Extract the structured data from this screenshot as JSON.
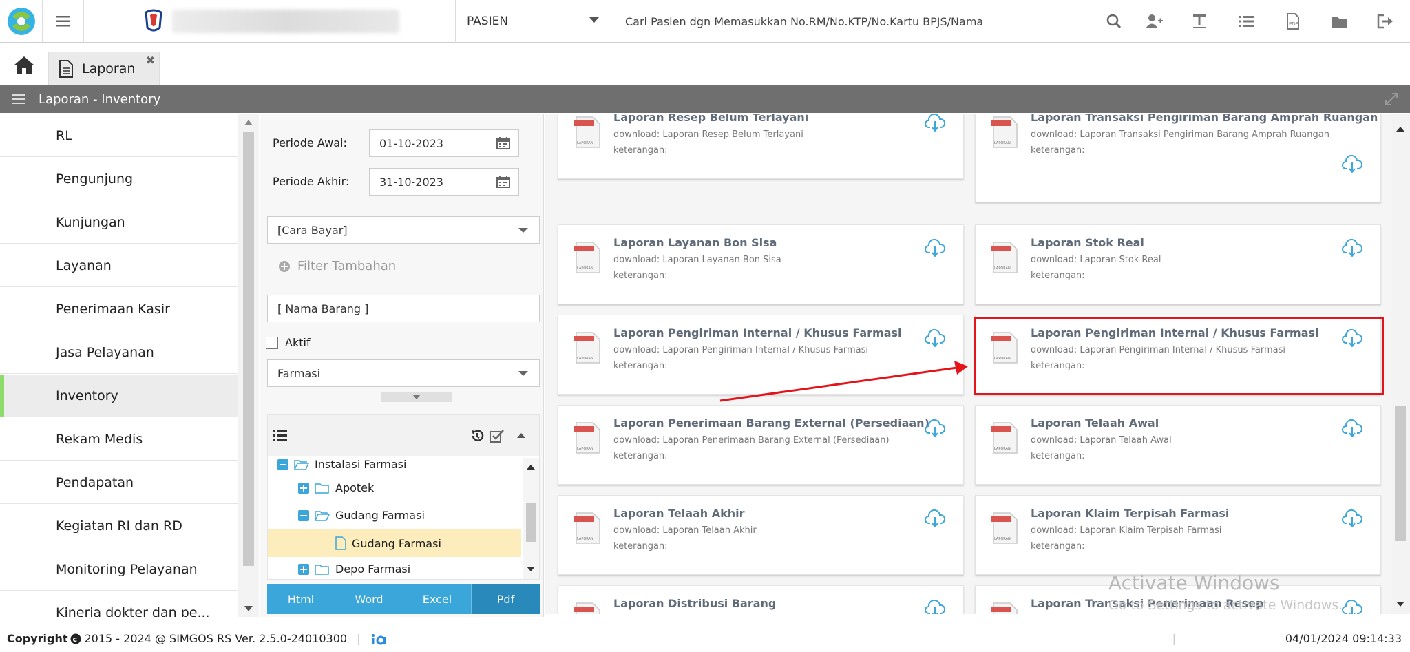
{
  "topbar": {
    "patient_select": "PASIEN",
    "search_placeholder": "Cari Pasien dgn Memasukkan No.RM/No.KTP/No.Kartu BPJS/Nama"
  },
  "tabs": [
    {
      "label": "Laporan"
    }
  ],
  "title": "Laporan - Inventory",
  "sidebar": {
    "items": [
      {
        "label": "RL"
      },
      {
        "label": "Pengunjung"
      },
      {
        "label": "Kunjungan"
      },
      {
        "label": "Layanan"
      },
      {
        "label": "Penerimaan Kasir"
      },
      {
        "label": "Jasa Pelayanan"
      },
      {
        "label": "Inventory"
      },
      {
        "label": "Rekam Medis"
      },
      {
        "label": "Pendapatan"
      },
      {
        "label": "Kegiatan RI dan RD"
      },
      {
        "label": "Monitoring Pelayanan"
      },
      {
        "label": "Kinerja dokter dan pe..."
      }
    ],
    "active_index": 6
  },
  "filter": {
    "periode_awal_label": "Periode Awal:",
    "periode_awal_value": "01-10-2023",
    "periode_akhir_label": "Periode Akhir:",
    "periode_akhir_value": "31-10-2023",
    "cara_bayar": "[Cara Bayar]",
    "filter_tambahan": "Filter Tambahan",
    "nama_barang": "[ Nama Barang ]",
    "aktif_label": "Aktif",
    "jenis": "Farmasi"
  },
  "tree": {
    "nodes": [
      {
        "label": "Instalasi Farmasi"
      },
      {
        "label": "Apotek"
      },
      {
        "label": "Gudang Farmasi"
      },
      {
        "label": "Gudang Farmasi"
      },
      {
        "label": "Depo Farmasi"
      }
    ]
  },
  "format_buttons": [
    {
      "label": "Html"
    },
    {
      "label": "Word"
    },
    {
      "label": "Excel"
    },
    {
      "label": "Pdf"
    }
  ],
  "reports": [
    {
      "title": "Laporan Resep Belum Terlayani",
      "download": "download: Laporan Resep Belum Terlayani",
      "keterangan": "keterangan:"
    },
    {
      "title": "Laporan Transaksi Pengiriman Barang Amprah Ruangan",
      "download": "download: Laporan Transaksi Pengiriman Barang Amprah Ruangan",
      "keterangan": "keterangan:"
    },
    {
      "title": "Laporan Layanan Bon Sisa",
      "download": "download: Laporan Layanan Bon Sisa",
      "keterangan": "keterangan:"
    },
    {
      "title": "Laporan Stok Real",
      "download": "download: Laporan Stok Real",
      "keterangan": "keterangan:"
    },
    {
      "title": "Laporan Pengiriman Internal / Khusus Farmasi",
      "download": "download: Laporan Pengiriman Internal / Khusus Farmasi",
      "keterangan": "keterangan:"
    },
    {
      "title": "Laporan Pengiriman Internal / Khusus Farmasi",
      "download": "download: Laporan Pengiriman Internal / Khusus Farmasi",
      "keterangan": "keterangan:"
    },
    {
      "title": "Laporan Penerimaan Barang External (Persediaan)",
      "download": "download: Laporan Penerimaan Barang External (Persediaan)",
      "keterangan": "keterangan:"
    },
    {
      "title": "Laporan Telaah Awal",
      "download": "download: Laporan Telaah Awal",
      "keterangan": "keterangan:"
    },
    {
      "title": "Laporan Telaah Akhir",
      "download": "download: Laporan Telaah Akhir",
      "keterangan": "keterangan:"
    },
    {
      "title": "Laporan Klaim Terpisah Farmasi",
      "download": "download: Laporan Klaim Terpisah Farmasi",
      "keterangan": "keterangan:"
    },
    {
      "title": "Laporan Distribusi Barang",
      "download": "",
      "keterangan": ""
    },
    {
      "title": "Laporan Transaksi Penerimaan Resep",
      "download": "",
      "keterangan": ""
    }
  ],
  "watermark": {
    "line1": "Activate Windows",
    "line2": "Go to Settings to activate Windows."
  },
  "footer": {
    "copyright": "Copyright",
    "text": "2015 - 2024 @ SIMGOS RS Ver. 2.5.0-24010300",
    "datetime": "04/01/2024 09:14:33"
  },
  "colors": {
    "accent": "#3aa6d9",
    "active_marker": "#8ddb6b",
    "highlight": "#e5141b",
    "titlebar": "#6f6f6f"
  }
}
